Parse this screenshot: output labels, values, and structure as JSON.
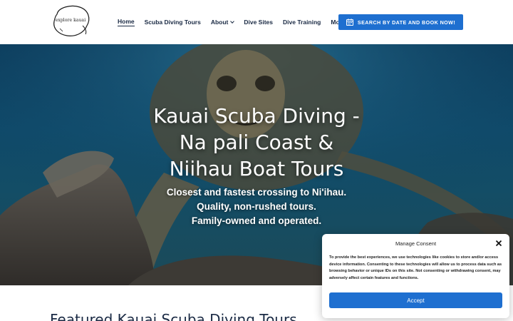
{
  "header": {
    "logo_text": "explore kauai",
    "nav": [
      {
        "label": "Home",
        "active": true,
        "dropdown": false
      },
      {
        "label": "Scuba Diving Tours",
        "active": false,
        "dropdown": false
      },
      {
        "label": "About",
        "active": false,
        "dropdown": true
      },
      {
        "label": "Dive Sites",
        "active": false,
        "dropdown": false
      },
      {
        "label": "Dive Training",
        "active": false,
        "dropdown": false
      },
      {
        "label": "More",
        "active": false,
        "dropdown": true
      }
    ],
    "cta_label": "SEARCH BY DATE AND BOOK NOW!",
    "cta_icon": "calendar-icon"
  },
  "hero": {
    "title_lines": [
      "Kauai Scuba Diving -",
      "Na pali Coast &",
      "Niihau Boat Tours"
    ],
    "subtitle_lines": [
      "Closest and fastest crossing to Ni'ihau.",
      "Quality, non-rushed tours.",
      "Family-owned and operated."
    ]
  },
  "featured_heading": "Featured Kauai Scuba Diving Tours",
  "consent": {
    "title": "Manage Consent",
    "text": "To provide the best experiences, we use technologies like cookies to store and/or access device information. Consenting to these technologies will allow us to process data such as browsing behavior or unique IDs on this site. Not consenting or withdrawing consent, may adversely affect certain features and functions.",
    "accept_label": "Accept",
    "close_icon": "close-icon"
  },
  "colors": {
    "accent": "#1e6fd0",
    "nav_text": "#1a2a44",
    "hero_water": "#0f4a6a"
  }
}
